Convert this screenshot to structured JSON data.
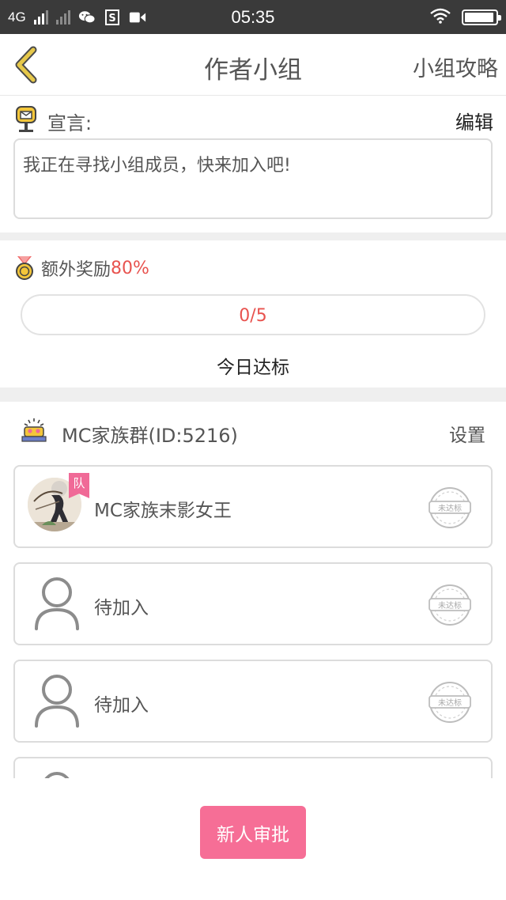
{
  "status_bar": {
    "network": "4G",
    "time": "05:35",
    "battery_level": 0.95,
    "icons": [
      "signal-icon",
      "signal-weak-icon",
      "wechat-icon",
      "sim-s-icon",
      "video-icon",
      "wifi-icon",
      "battery-icon"
    ]
  },
  "header": {
    "title": "作者小组",
    "guide_label": "小组攻略",
    "back_icon": "chevron-left-icon"
  },
  "declaration": {
    "label": "宣言:",
    "edit_label": "编辑",
    "text": "我正在寻找小组成员，快来加入吧!",
    "icon": "mailbox-icon"
  },
  "reward": {
    "label": "额外奖励",
    "percent": "80%",
    "icon": "medal-icon",
    "progress_text": "0/5",
    "progress_value": 0,
    "goal_label": "今日达标"
  },
  "group": {
    "name": "MC家族群(ID:5216)",
    "settings_label": "设置",
    "icon": "group-badge-icon"
  },
  "members": [
    {
      "name": "MC家族末影女王",
      "badge": "队",
      "stamp": "未达标",
      "avatar": "character-avatar"
    },
    {
      "name": "待加入",
      "stamp": "未达标",
      "avatar": "person-placeholder-icon"
    },
    {
      "name": "待加入",
      "stamp": "未达标",
      "avatar": "person-placeholder-icon"
    },
    {
      "name": "",
      "stamp": "",
      "avatar": "person-placeholder-icon"
    }
  ],
  "approve_button": "新人审批",
  "colors": {
    "accent_pink": "#f66e96",
    "reward_red": "#e8534f",
    "back_arrow": "#e6c84a"
  }
}
